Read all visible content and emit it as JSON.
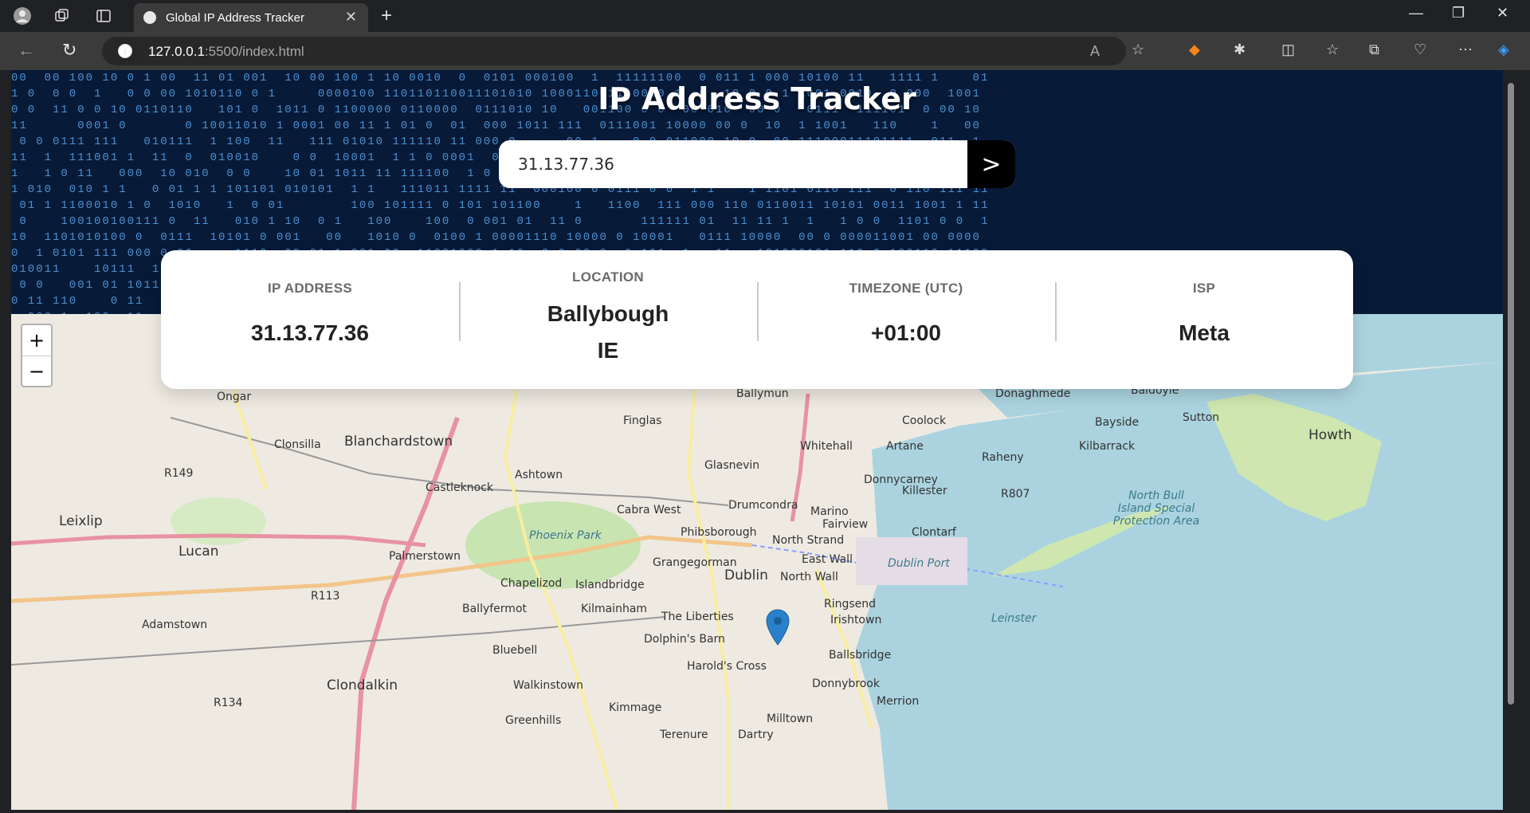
{
  "browser": {
    "tab_title": "Global IP Address Tracker",
    "url_host": "127.0.0.1",
    "url_rest": ":5500/index.html"
  },
  "header": {
    "title": "IP Address Tracker",
    "search_value": "31.13.77.36",
    "submit_glyph": ">"
  },
  "info": {
    "ip": {
      "label": "IP ADDRESS",
      "value": "31.13.77.36"
    },
    "location": {
      "label": "LOCATION",
      "city": "Ballybough",
      "country": "IE"
    },
    "timezone": {
      "label": "TIMEZONE (UTC)",
      "value": "+01:00"
    },
    "isp": {
      "label": "ISP",
      "value": "Meta"
    }
  },
  "map": {
    "zoom_in": "+",
    "zoom_out": "−",
    "places": [
      "Ongar",
      "Ballymun",
      "Donaghmede",
      "Baldoyle",
      "Finglas",
      "Coolock",
      "Bayside",
      "Sutton",
      "Howth",
      "Clonsilla",
      "Blanchardstown",
      "Whitehall",
      "Artane",
      "Kilbarrack",
      "Raheny",
      "R149",
      "Ashtown",
      "Glasnevin",
      "Donnycarney",
      "Castleknock",
      "Killester",
      "R807",
      "North Bull Island Special Protection Area",
      "Leixlip",
      "Cabra West",
      "Drumcondra",
      "Marino",
      "Phoenix Park",
      "Phibsborough",
      "Fairview",
      "Clontarf",
      "North Strand",
      "Lucan",
      "Palmerstown",
      "Grangegorman",
      "East Wall",
      "Dublin",
      "Dublin Port",
      "North Wall",
      "Chapelizod",
      "Islandbridge",
      "R113",
      "Kilmainham",
      "Ringsend",
      "Ballyfermot",
      "The Liberties",
      "Irishtown",
      "Leinster",
      "Adamstown",
      "Dolphin's Barn",
      "Bluebell",
      "Ballsbridge",
      "Harold's Cross",
      "Clondalkin",
      "Walkinstown",
      "Donnybrook",
      "R134",
      "Kimmage",
      "Merrion",
      "Greenhills",
      "Milltown",
      "Terenure",
      "Dartry"
    ]
  }
}
